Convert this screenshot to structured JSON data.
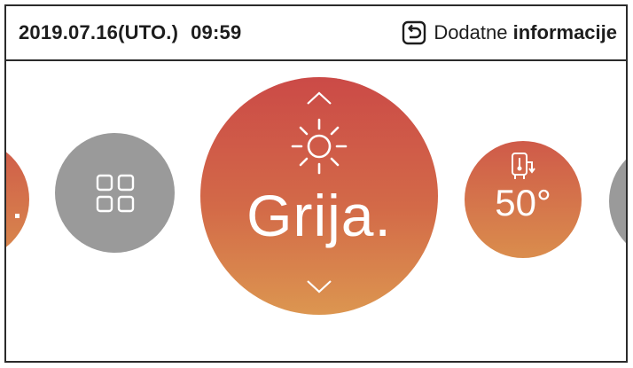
{
  "header": {
    "date": "2019.07.16(UTO.)",
    "time": "09:59",
    "info_button": {
      "label_light": "Dodatne",
      "label_bold": "informacije",
      "icon": "return-icon"
    }
  },
  "carousel": {
    "main": {
      "mode_label": "Grija.",
      "icon": "sun-icon",
      "up_icon": "chevron-up-icon",
      "down_icon": "chevron-down-icon"
    },
    "menu": {
      "icon": "grid-menu-icon"
    },
    "water_heater": {
      "icon": "water-tank-icon",
      "temperature": "50°"
    }
  },
  "colors": {
    "accent_top": "#cb4a47",
    "accent_bottom": "#dc9650",
    "neutral": "#9a9a9a",
    "text": "#1d1d1d",
    "white": "#ffffff"
  }
}
